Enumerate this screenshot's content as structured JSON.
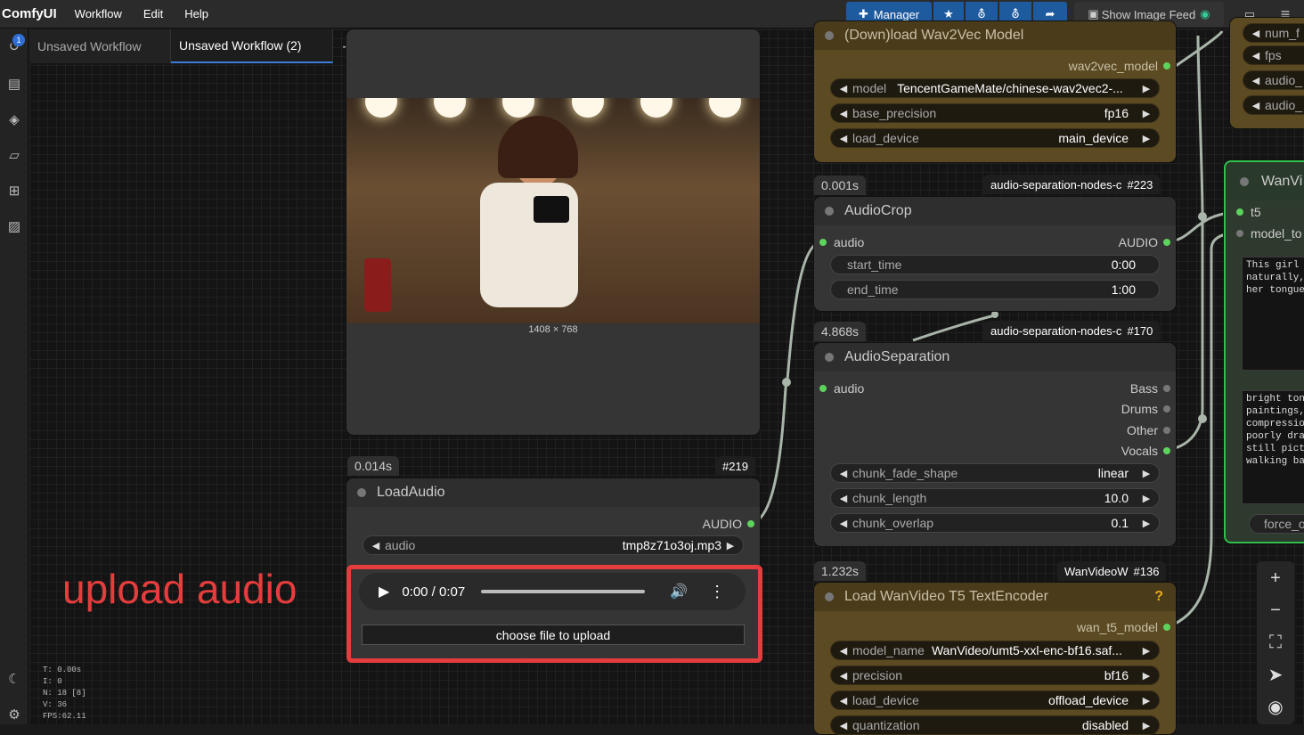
{
  "topbar": {
    "brand": "ComfyUI",
    "menus": [
      "Workflow",
      "Edit",
      "Help"
    ],
    "manager_label": "Manager",
    "feed_label": "Show Image Feed"
  },
  "sidebar": {
    "queue_badge": "1"
  },
  "tabs": [
    "Unsaved Workflow",
    "Unsaved Workflow (2)"
  ],
  "image_node": {
    "dimensions": "1408 × 768"
  },
  "load_audio": {
    "time": "0.014s",
    "id": "#219",
    "title": "LoadAudio",
    "output": "AUDIO",
    "widget_label": "audio",
    "widget_value": "tmp8z71o3oj.mp3",
    "player_time": "0:00 / 0:07",
    "upload_button": "choose file to upload"
  },
  "annotation": {
    "text": "upload audio"
  },
  "wav2vec": {
    "title": "(Down)load Wav2Vec Model",
    "output": "wav2vec_model",
    "widgets": [
      {
        "label": "model",
        "value": "TencentGameMate/chinese-wav2vec2-..."
      },
      {
        "label": "base_precision",
        "value": "fp16"
      },
      {
        "label": "load_device",
        "value": "main_device"
      }
    ]
  },
  "audio_crop": {
    "time": "0.001s",
    "source": "audio-separation-nodes-c",
    "id": "#223",
    "title": "AudioCrop",
    "input": "audio",
    "output": "AUDIO",
    "widgets": [
      {
        "label": "start_time",
        "value": "0:00"
      },
      {
        "label": "end_time",
        "value": "1:00"
      }
    ]
  },
  "audio_sep": {
    "time": "4.868s",
    "source": "audio-separation-nodes-c",
    "id": "#170",
    "title": "AudioSeparation",
    "input": "audio",
    "outputs": [
      "Bass",
      "Drums",
      "Other",
      "Vocals"
    ],
    "widgets": [
      {
        "label": "chunk_fade_shape",
        "value": "linear"
      },
      {
        "label": "chunk_length",
        "value": "10.0"
      },
      {
        "label": "chunk_overlap",
        "value": "0.1"
      }
    ]
  },
  "t5": {
    "time": "1.232s",
    "source": "WanVideoW",
    "id": "#136",
    "title": "Load WanVideo T5 TextEncoder",
    "help": "?",
    "output": "wan_t5_model",
    "widgets": [
      {
        "label": "model_name",
        "value": "WanVideo/umt5-xxl-enc-bf16.saf..."
      },
      {
        "label": "precision",
        "value": "bf16"
      },
      {
        "label": "load_device",
        "value": "offload_device"
      },
      {
        "label": "quantization",
        "value": "disabled"
      }
    ]
  },
  "right_top_node": {
    "inputs": [
      "num_f",
      "fps",
      "audio_",
      "audio_"
    ]
  },
  "wanvi": {
    "title": "WanVi",
    "inputs": [
      "t5",
      "model_to"
    ],
    "prompt": "This girl \nnaturally,\nher tongue",
    "negative": "bright tone\npaintings,\ncompression\npoorly draw\nstill pictu\nwalking bac",
    "button": "force_o"
  },
  "stats": [
    "T: 0.00s",
    "I: 0",
    "N: 18 [8]",
    "V: 36",
    "FPS:62.11"
  ]
}
